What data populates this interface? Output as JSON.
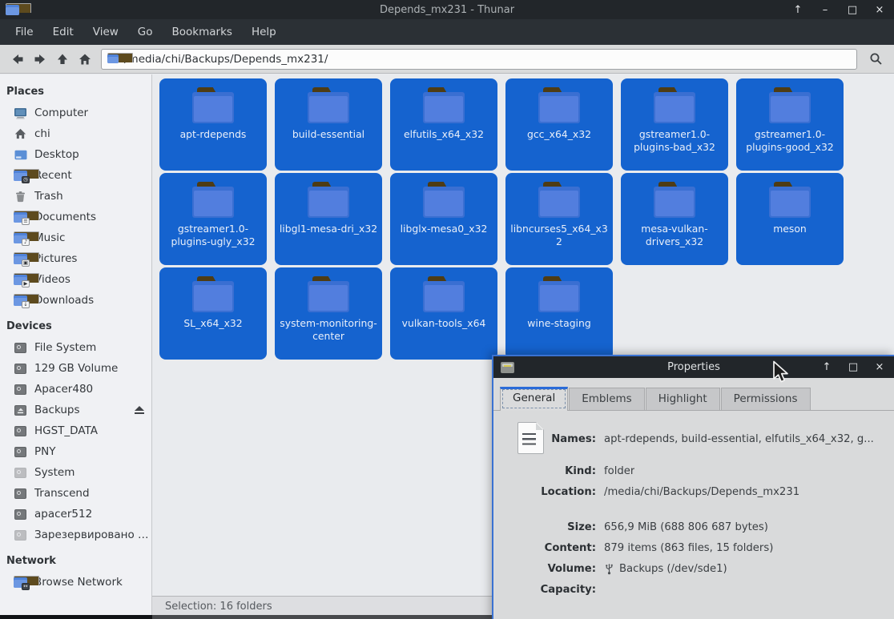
{
  "window": {
    "title": "Depends_mx231 - Thunar",
    "controls": {
      "shade": "↑",
      "minimize": "–",
      "maximize": "□",
      "close": "×"
    }
  },
  "menubar": {
    "items": [
      "File",
      "Edit",
      "View",
      "Go",
      "Bookmarks",
      "Help"
    ]
  },
  "toolbar": {
    "path": "/media/chi/Backups/Depends_mx231/"
  },
  "sidebar": {
    "places_title": "Places",
    "places": [
      {
        "label": "Computer",
        "icon": "computer"
      },
      {
        "label": "chi",
        "icon": "home"
      },
      {
        "label": "Desktop",
        "icon": "desktop"
      },
      {
        "label": "Recent",
        "icon": "folder-recent",
        "emblem": "◷"
      },
      {
        "label": "Trash",
        "icon": "trash"
      },
      {
        "label": "Documents",
        "icon": "folder-documents",
        "emblem": "≡"
      },
      {
        "label": "Music",
        "icon": "folder-music",
        "emblem": "♪"
      },
      {
        "label": "Pictures",
        "icon": "folder-pictures",
        "emblem": "▣"
      },
      {
        "label": "Videos",
        "icon": "folder-videos",
        "emblem": "▶"
      },
      {
        "label": "Downloads",
        "icon": "folder-downloads",
        "emblem": "↓"
      }
    ],
    "devices_title": "Devices",
    "devices": [
      {
        "label": "File System",
        "icon": "drive"
      },
      {
        "label": "129 GB Volume",
        "icon": "drive"
      },
      {
        "label": "Apacer480",
        "icon": "drive"
      },
      {
        "label": "Backups",
        "icon": "drive-eject",
        "eject": true
      },
      {
        "label": "HGST_DATA",
        "icon": "drive"
      },
      {
        "label": "PNY",
        "icon": "drive"
      },
      {
        "label": "System",
        "icon": "drive",
        "faded": true
      },
      {
        "label": "Transcend",
        "icon": "drive"
      },
      {
        "label": "apacer512",
        "icon": "drive"
      },
      {
        "label": "Зарезервировано …",
        "icon": "drive",
        "faded": true
      }
    ],
    "network_title": "Network",
    "network": [
      {
        "label": "Browse Network",
        "icon": "folder-network",
        "emblem": "↔"
      }
    ]
  },
  "files": {
    "selected_count": 16,
    "folders": [
      "apt-rdepends",
      "build-essential",
      "elfutils_x64_x32",
      "gcc_x64_x32",
      "gstreamer1.0-plugins-bad_x32",
      "gstreamer1.0-plugins-good_x32",
      "gstreamer1.0-plugins-ugly_x32",
      "libgl1-mesa-dri_x32",
      "libglx-mesa0_x32",
      "libncurses5_x64_x32",
      "mesa-vulkan-drivers_x32",
      "meson",
      "SL_x64_x32",
      "system-monitoring-center",
      "vulkan-tools_x64",
      "wine-staging"
    ]
  },
  "statusbar": {
    "text": "Selection: 16 folders"
  },
  "dialog": {
    "title": "Properties",
    "controls": {
      "shade": "↑",
      "maximize": "□",
      "close": "×"
    },
    "tabs": [
      {
        "label": "General"
      },
      {
        "label": "Emblems"
      },
      {
        "label": "Highlight"
      },
      {
        "label": "Permissions"
      }
    ],
    "fields": {
      "names_label": "Names:",
      "names_value": "apt-rdepends, build-essential, elfutils_x64_x32, g...",
      "kind_label": "Kind:",
      "kind_value": "folder",
      "location_label": "Location:",
      "location_value": "/media/chi/Backups/Depends_mx231",
      "size_label": "Size:",
      "size_value": "656,9 MiB (688 806 687 bytes)",
      "content_label": "Content:",
      "content_value": "879 items (863 files, 15 folders)",
      "volume_label": "Volume:",
      "volume_value": "Backups (/dev/sde1)",
      "capacity_label": "Capacity:",
      "capacity_value": ""
    }
  },
  "colors": {
    "selection": "#1563cf",
    "accent": "#2a6bd8",
    "titlebar": "#22262a",
    "menubar": "#2b3035",
    "toolbar": "#d9dadb",
    "sidebar_bg": "#f0f1f4",
    "main_bg": "#e9ebee"
  }
}
